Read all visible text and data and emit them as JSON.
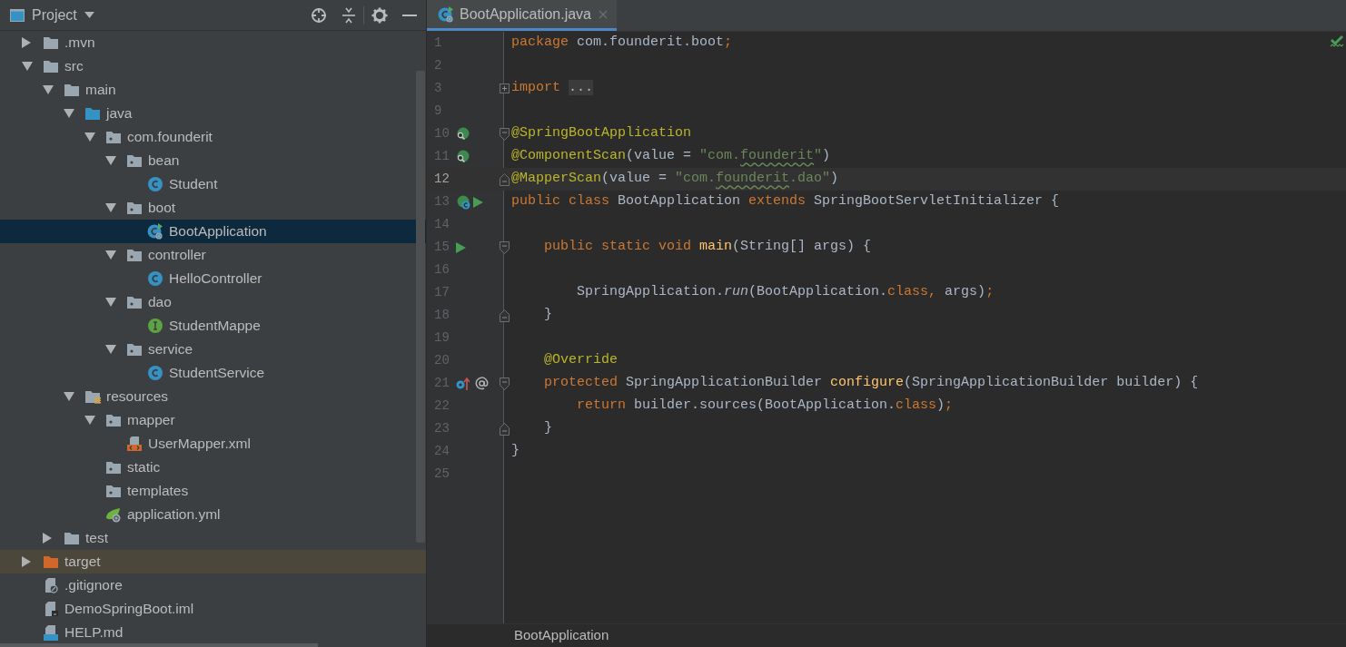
{
  "project_panel": {
    "title": "Project"
  },
  "tree": [
    {
      "label": ".mvn",
      "kind": "folder",
      "expanded": false,
      "selected": false
    },
    {
      "label": "src",
      "kind": "folder",
      "expanded": true,
      "selected": false,
      "children": [
        {
          "label": "main",
          "kind": "folder",
          "expanded": true,
          "selected": false,
          "children": [
            {
              "label": "java",
              "kind": "source-folder",
              "expanded": true,
              "selected": false,
              "children": [
                {
                  "label": "com.founderit",
                  "kind": "package",
                  "expanded": true,
                  "selected": false,
                  "children": [
                    {
                      "label": "bean",
                      "kind": "package",
                      "expanded": true,
                      "selected": false,
                      "children": [
                        {
                          "label": "Student",
                          "kind": "class",
                          "selected": false
                        }
                      ]
                    },
                    {
                      "label": "boot",
                      "kind": "package",
                      "expanded": true,
                      "selected": false,
                      "children": [
                        {
                          "label": "BootApplication",
                          "kind": "spring-class",
                          "selected": true
                        }
                      ]
                    },
                    {
                      "label": "controller",
                      "kind": "package",
                      "expanded": true,
                      "selected": false,
                      "children": [
                        {
                          "label": "HelloController",
                          "kind": "class",
                          "selected": false
                        }
                      ]
                    },
                    {
                      "label": "dao",
                      "kind": "package",
                      "expanded": true,
                      "selected": false,
                      "children": [
                        {
                          "label": "StudentMappe",
                          "kind": "interface",
                          "selected": false
                        }
                      ]
                    },
                    {
                      "label": "service",
                      "kind": "package",
                      "expanded": true,
                      "selected": false,
                      "children": [
                        {
                          "label": "StudentService",
                          "kind": "class",
                          "selected": false
                        }
                      ]
                    }
                  ]
                }
              ]
            },
            {
              "label": "resources",
              "kind": "resources-folder",
              "expanded": true,
              "selected": false,
              "children": [
                {
                  "label": "mapper",
                  "kind": "package",
                  "expanded": true,
                  "selected": false,
                  "children": [
                    {
                      "label": "UserMapper.xml",
                      "kind": "xml",
                      "selected": false
                    }
                  ]
                },
                {
                  "label": "static",
                  "kind": "package",
                  "selected": false
                },
                {
                  "label": "templates",
                  "kind": "package",
                  "selected": false
                },
                {
                  "label": "application.yml",
                  "kind": "spring-config",
                  "selected": false
                }
              ]
            }
          ]
        },
        {
          "label": "test",
          "kind": "folder",
          "expanded": false,
          "selected": false
        }
      ]
    },
    {
      "label": "target",
      "kind": "excluded-folder",
      "expanded": false,
      "selected": false
    },
    {
      "label": ".gitignore",
      "kind": "ignore-file",
      "selected": false
    },
    {
      "label": "DemoSpringBoot.iml",
      "kind": "module-file",
      "selected": false
    },
    {
      "label": "HELP.md",
      "kind": "markdown",
      "selected": false
    }
  ],
  "tabs": [
    {
      "label": "BootApplication.java",
      "kind": "spring-class",
      "selected": true
    }
  ],
  "code_lines": [
    {
      "number": "1",
      "current": false,
      "tokens": [
        {
          "kind": "keyword",
          "text": "package "
        },
        {
          "kind": "plain",
          "text": "com.founderit.boot"
        },
        {
          "kind": "keyword",
          "text": ";"
        }
      ]
    },
    {
      "number": "2",
      "current": false
    },
    {
      "number": "3",
      "current": false,
      "fold": {
        "kind": "collapsed"
      },
      "tokens": [
        {
          "kind": "keyword",
          "text": "import "
        },
        {
          "kind": "folded",
          "text": "..."
        }
      ]
    },
    {
      "number": "9",
      "current": false
    },
    {
      "number": "10",
      "current": false,
      "fold": {
        "kind": "start"
      },
      "markers": [
        {
          "kind": "bean"
        }
      ],
      "tokens": [
        {
          "kind": "annotation",
          "text": "@SpringBootApplication"
        }
      ]
    },
    {
      "number": "11",
      "current": false,
      "markers": [
        {
          "kind": "bean"
        }
      ],
      "tokens": [
        {
          "kind": "annotation",
          "text": "@ComponentScan"
        },
        {
          "kind": "plain",
          "text": "(value = "
        },
        {
          "kind": "string",
          "text": "\"com."
        },
        {
          "kind": "typo",
          "text": "founderit"
        },
        {
          "kind": "string",
          "text": "\""
        },
        {
          "kind": "plain",
          "text": ")"
        }
      ]
    },
    {
      "number": "12",
      "current": true,
      "fold": {
        "kind": "end"
      },
      "tokens": [
        {
          "kind": "annotation",
          "text": "@MapperScan"
        },
        {
          "kind": "plain",
          "text": "(value = "
        },
        {
          "kind": "string",
          "text": "\"com."
        },
        {
          "kind": "typo",
          "text": "founderit"
        },
        {
          "kind": "string",
          "text": ".dao\""
        },
        {
          "kind": "plain",
          "text": ")"
        }
      ]
    },
    {
      "number": "13",
      "current": false,
      "markers": [
        {
          "kind": "spring-boot"
        },
        {
          "kind": "run"
        }
      ],
      "tokens": [
        {
          "kind": "keyword",
          "text": "public class "
        },
        {
          "kind": "plain",
          "text": "BootApplication "
        },
        {
          "kind": "keyword",
          "text": "extends "
        },
        {
          "kind": "plain",
          "text": "SpringBootServletInitializer {"
        }
      ]
    },
    {
      "number": "14",
      "current": false
    },
    {
      "number": "15",
      "current": false,
      "fold": {
        "kind": "start"
      },
      "markers": [
        {
          "kind": "run"
        }
      ],
      "tokens": [
        {
          "kind": "keyword",
          "text": "    public static void "
        },
        {
          "kind": "method",
          "text": "main"
        },
        {
          "kind": "plain",
          "text": "(String[] args) {"
        }
      ]
    },
    {
      "number": "16",
      "current": false
    },
    {
      "number": "17",
      "current": false,
      "tokens": [
        {
          "kind": "plain",
          "text": "        SpringApplication."
        },
        {
          "kind": "static-call",
          "text": "run"
        },
        {
          "kind": "plain",
          "text": "(BootApplication."
        },
        {
          "kind": "keyword",
          "text": "class, "
        },
        {
          "kind": "plain",
          "text": "args)"
        },
        {
          "kind": "keyword",
          "text": ";"
        }
      ]
    },
    {
      "number": "18",
      "current": false,
      "fold": {
        "kind": "end"
      },
      "tokens": [
        {
          "kind": "plain",
          "text": "    }"
        }
      ]
    },
    {
      "number": "19",
      "current": false
    },
    {
      "number": "20",
      "current": false,
      "tokens": [
        {
          "kind": "annotation",
          "text": "    @Override"
        }
      ]
    },
    {
      "number": "21",
      "current": false,
      "fold": {
        "kind": "start"
      },
      "markers": [
        {
          "kind": "override"
        },
        {
          "kind": "at"
        }
      ],
      "tokens": [
        {
          "kind": "keyword",
          "text": "    protected "
        },
        {
          "kind": "plain",
          "text": "SpringApplicationBuilder "
        },
        {
          "kind": "method",
          "text": "configure"
        },
        {
          "kind": "plain",
          "text": "(SpringApplicationBuilder builder) {"
        }
      ]
    },
    {
      "number": "22",
      "current": false,
      "tokens": [
        {
          "kind": "keyword",
          "text": "        return "
        },
        {
          "kind": "plain",
          "text": "builder.sources(BootApplication."
        },
        {
          "kind": "keyword",
          "text": "class"
        },
        {
          "kind": "plain",
          "text": ")"
        },
        {
          "kind": "keyword",
          "text": ";"
        }
      ]
    },
    {
      "number": "23",
      "current": false,
      "fold": {
        "kind": "end"
      },
      "tokens": [
        {
          "kind": "plain",
          "text": "    }"
        }
      ]
    },
    {
      "number": "24",
      "current": false,
      "tokens": [
        {
          "kind": "plain",
          "text": "}"
        }
      ]
    },
    {
      "number": "25",
      "current": false
    }
  ],
  "breadcrumb": [
    "BootApplication"
  ]
}
